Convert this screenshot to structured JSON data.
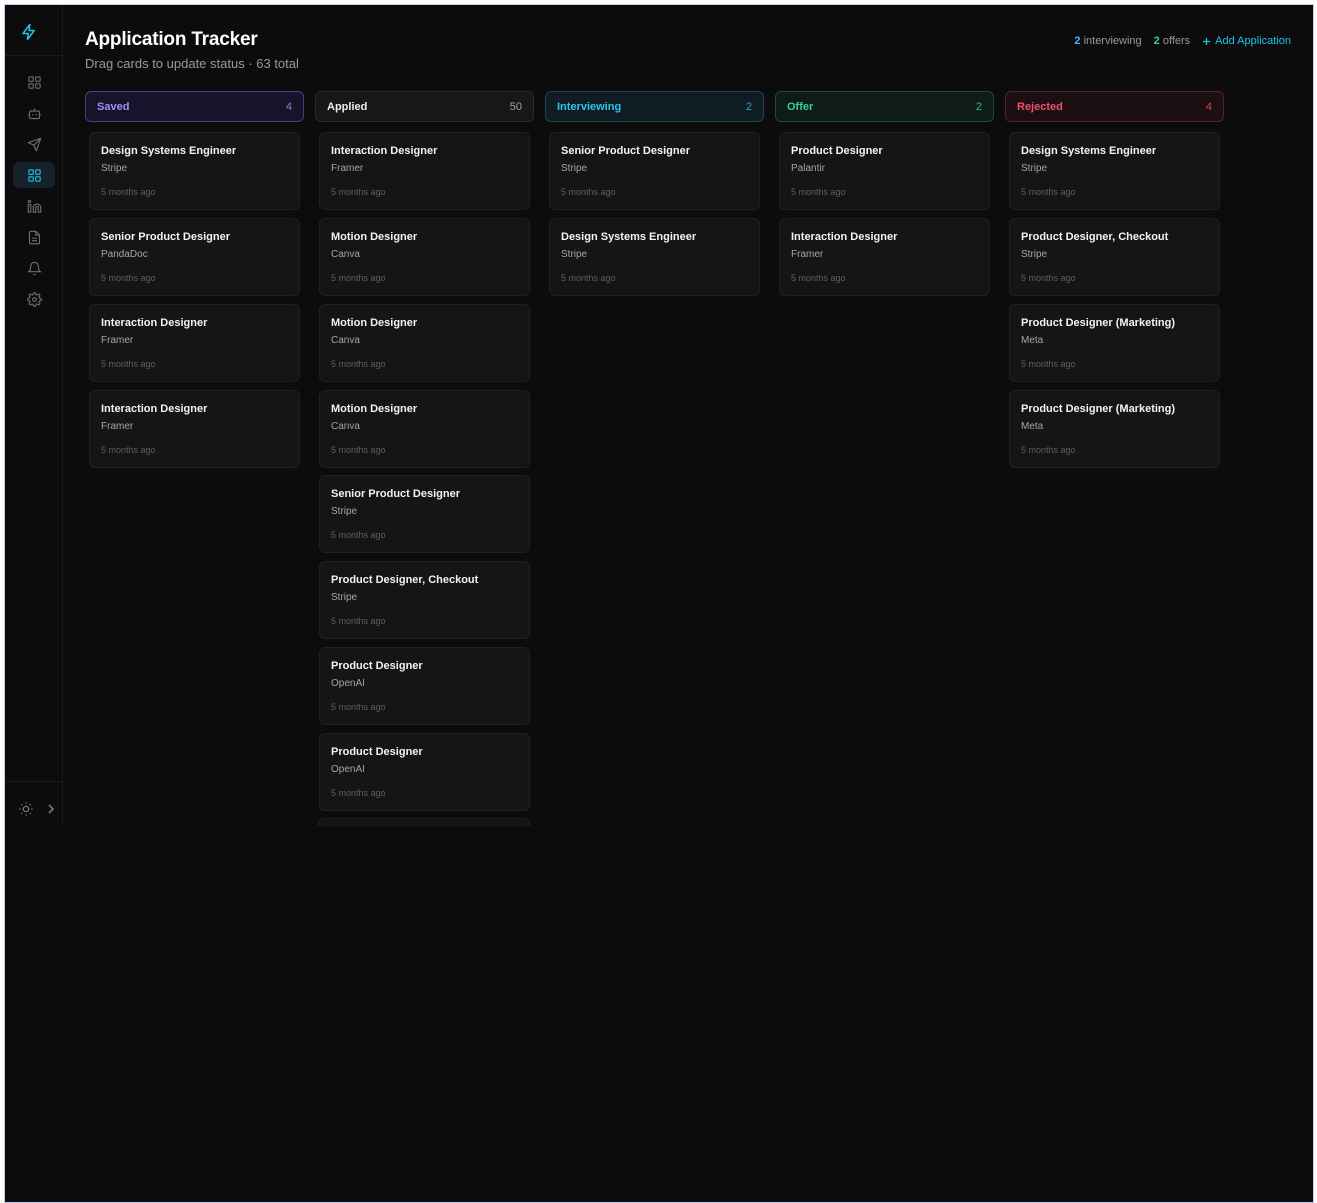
{
  "header": {
    "title": "Application Tracker",
    "subtitle": "Drag cards to update status · 63 total",
    "interviewing_count": "2",
    "interviewing_label": " interviewing",
    "offers_count": "2",
    "offers_label": " offers",
    "add_label": "Add Application"
  },
  "sidebar": {
    "items": [
      {
        "icon": "dashboard-icon",
        "active": false
      },
      {
        "icon": "bot-icon",
        "active": false
      },
      {
        "icon": "send-icon",
        "active": false
      },
      {
        "icon": "board-icon",
        "active": true
      },
      {
        "icon": "linkedin-icon",
        "active": false
      },
      {
        "icon": "document-icon",
        "active": false
      },
      {
        "icon": "bell-icon",
        "active": false
      },
      {
        "icon": "gear-icon",
        "active": false
      }
    ]
  },
  "columns": [
    {
      "name": "Saved",
      "count": "4",
      "cards": [
        {
          "title": "Design Systems Engineer",
          "company": "Stripe",
          "time": "5 months ago"
        },
        {
          "title": "Senior Product Designer",
          "company": "PandaDoc",
          "time": "5 months ago"
        },
        {
          "title": "Interaction Designer",
          "company": "Framer",
          "time": "5 months ago"
        },
        {
          "title": "Interaction Designer",
          "company": "Framer",
          "time": "5 months ago"
        }
      ]
    },
    {
      "name": "Applied",
      "count": "50",
      "cards": [
        {
          "title": "Interaction Designer",
          "company": "Framer",
          "time": "5 months ago"
        },
        {
          "title": "Motion Designer",
          "company": "Canva",
          "time": "5 months ago"
        },
        {
          "title": "Motion Designer",
          "company": "Canva",
          "time": "5 months ago"
        },
        {
          "title": "Motion Designer",
          "company": "Canva",
          "time": "5 months ago"
        },
        {
          "title": "Senior Product Designer",
          "company": "Stripe",
          "time": "5 months ago"
        },
        {
          "title": "Product Designer, Checkout",
          "company": "Stripe",
          "time": "5 months ago"
        },
        {
          "title": "Product Designer",
          "company": "OpenAI",
          "time": "5 months ago"
        },
        {
          "title": "Product Designer",
          "company": "OpenAI",
          "time": "5 months ago"
        }
      ]
    },
    {
      "name": "Interviewing",
      "count": "2",
      "cards": [
        {
          "title": "Senior Product Designer",
          "company": "Stripe",
          "time": "5 months ago"
        },
        {
          "title": "Design Systems Engineer",
          "company": "Stripe",
          "time": "5 months ago"
        }
      ]
    },
    {
      "name": "Offer",
      "count": "2",
      "cards": [
        {
          "title": "Product Designer",
          "company": "Palantir",
          "time": "5 months ago"
        },
        {
          "title": "Interaction Designer",
          "company": "Framer",
          "time": "5 months ago"
        }
      ]
    },
    {
      "name": "Rejected",
      "count": "4",
      "cards": [
        {
          "title": "Design Systems Engineer",
          "company": "Stripe",
          "time": "5 months ago"
        },
        {
          "title": "Product Designer, Checkout",
          "company": "Stripe",
          "time": "5 months ago"
        },
        {
          "title": "Product Designer (Marketing)",
          "company": "Meta",
          "time": "5 months ago"
        },
        {
          "title": "Product Designer (Marketing)",
          "company": "Meta",
          "time": "5 months ago"
        }
      ]
    }
  ],
  "colors": {
    "accent": "#22c3e6",
    "saved": "#a78bfa",
    "interviewing": "#2cc8ec",
    "offer": "#34d399",
    "rejected": "#f0516b",
    "background": "#0c0c0c"
  }
}
